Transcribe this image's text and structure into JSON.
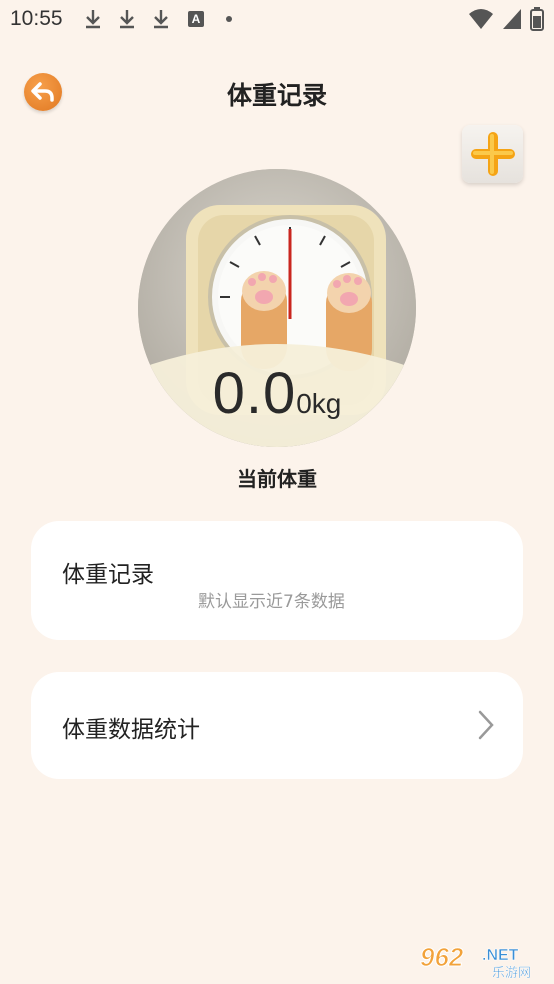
{
  "status_bar": {
    "time": "10:55",
    "left_icons": [
      "download-icon",
      "download-icon",
      "download-icon",
      "a-icon",
      "dot-icon"
    ],
    "a_icon_text": "A",
    "right_icons": [
      "wifi-icon",
      "signal-icon",
      "battery-icon"
    ]
  },
  "header": {
    "title": "体重记录",
    "back_icon": "back-arrow-icon",
    "add_icon": "plus-icon"
  },
  "scale": {
    "image": "cat-paw-scale-illustration",
    "weight_value": "0.0",
    "weight_unit": "0kg",
    "label": "当前体重"
  },
  "cards": {
    "records": {
      "title": "体重记录",
      "subtitle": "默认显示近7条数据"
    },
    "stats": {
      "title": "体重数据统计",
      "chevron_icon": "chevron-right-icon"
    }
  },
  "watermark": {
    "text": "962",
    "suffix": ".NET",
    "sub": "乐游网"
  },
  "colors": {
    "background": "#fcf3eb",
    "accent": "#f08a2c",
    "card": "#ffffff"
  }
}
